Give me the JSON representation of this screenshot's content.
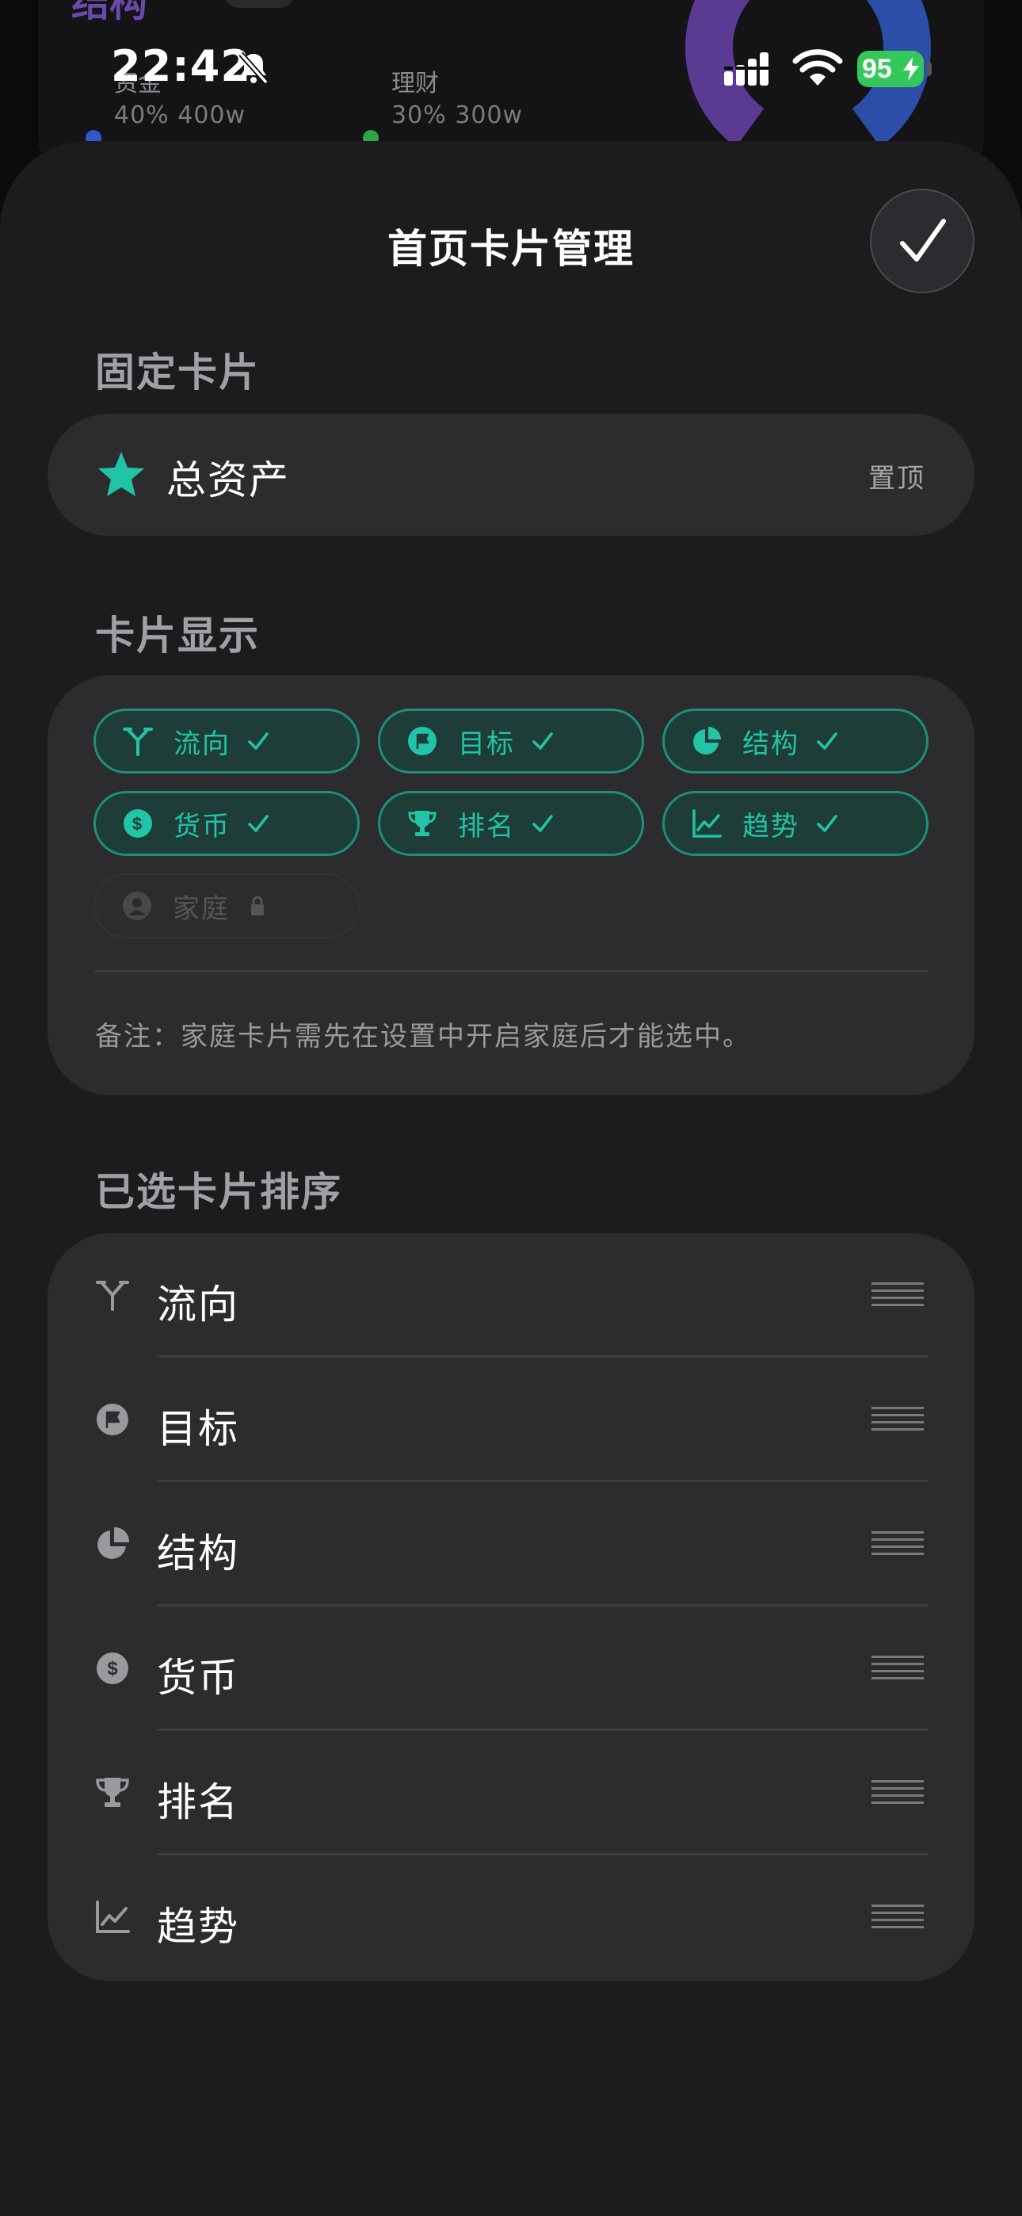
{
  "background": {
    "title": "结构",
    "legend": [
      {
        "name": "资金",
        "pct": "40%",
        "amount": "400w",
        "color": "#2d59c9"
      },
      {
        "name": "理财",
        "pct": "30%",
        "amount": "300w",
        "color": "#2fa24a"
      }
    ]
  },
  "status_bar": {
    "time": "22:42",
    "battery": "95"
  },
  "sheet": {
    "title": "首页卡片管理"
  },
  "pinned_section": {
    "title": "固定卡片",
    "card": {
      "name": "总资产",
      "pin_label": "置顶",
      "icon": "star-icon"
    }
  },
  "display_section": {
    "title": "卡片显示",
    "chips": [
      {
        "label": "流向",
        "icon": "flow-icon",
        "selected": true
      },
      {
        "label": "目标",
        "icon": "flag-icon",
        "selected": true
      },
      {
        "label": "结构",
        "icon": "pie-icon",
        "selected": true
      },
      {
        "label": "货币",
        "icon": "currency-icon",
        "selected": true
      },
      {
        "label": "排名",
        "icon": "trophy-icon",
        "selected": true
      },
      {
        "label": "趋势",
        "icon": "trend-icon",
        "selected": true
      },
      {
        "label": "家庭",
        "icon": "person-icon",
        "selected": false,
        "locked": true
      }
    ],
    "note": "备注：家庭卡片需先在设置中开启家庭后才能选中。"
  },
  "sorted_section": {
    "title": "已选卡片排序",
    "items": [
      {
        "label": "流向",
        "icon": "flow-icon"
      },
      {
        "label": "目标",
        "icon": "flag-icon"
      },
      {
        "label": "结构",
        "icon": "pie-icon"
      },
      {
        "label": "货币",
        "icon": "currency-icon"
      },
      {
        "label": "排名",
        "icon": "trophy-icon"
      },
      {
        "label": "趋势",
        "icon": "trend-icon"
      }
    ]
  },
  "colors": {
    "accent": "#21c4a7",
    "chip_bg": "#1f3d38",
    "sheet_bg": "#1c1c1e",
    "group_bg": "#2c2c2e",
    "battery": "#34c759"
  }
}
